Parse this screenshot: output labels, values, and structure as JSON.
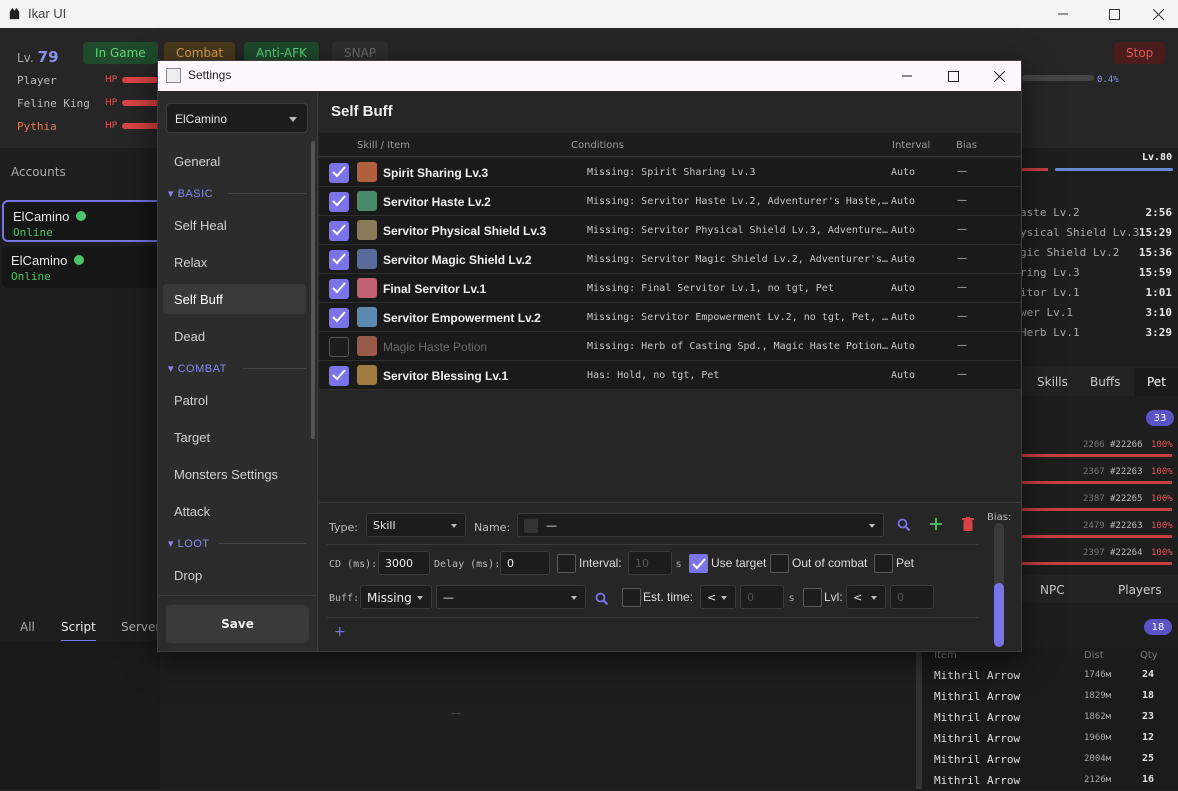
{
  "app": {
    "title": "Ikar UI",
    "level_label": "Lv.",
    "level": "79",
    "status_pills": [
      "In Game",
      "Combat",
      "Anti-AFK",
      "SNAP"
    ],
    "stop_label": "Stop",
    "party": [
      {
        "name": "Player",
        "hp": "HP"
      },
      {
        "name": "Feline King",
        "hp": "HP"
      },
      {
        "name": "Pythia",
        "hp": "HP"
      }
    ],
    "xp_percent": "0.4%",
    "accounts_header": "Accounts",
    "accounts": [
      {
        "name": "ElCamino",
        "status": "Online"
      },
      {
        "name": "ElCamino",
        "status": "Online"
      }
    ],
    "bottom_tabs": [
      "All",
      "Script",
      "Server"
    ],
    "right": {
      "pet_level": "Lv.80",
      "buffs": [
        {
          "name": "aste Lv.2",
          "time": "2:56"
        },
        {
          "name": "ysical Shield Lv.3",
          "time": "15:29"
        },
        {
          "name": "gic Shield Lv.2",
          "time": "15:36"
        },
        {
          "name": "ring Lv.3",
          "time": "15:59"
        },
        {
          "name": "itor Lv.1",
          "time": "1:01"
        },
        {
          "name": "wer Lv.1",
          "time": "3:10"
        },
        {
          "name": "Herb Lv.1",
          "time": "3:29"
        }
      ],
      "tabs": [
        "Skills",
        "Buffs",
        "Pet"
      ],
      "targets_count": "33",
      "targets": [
        {
          "dist": "2266",
          "id": "#22266",
          "pct": "100%"
        },
        {
          "dist": "2367",
          "id": "#22263",
          "pct": "100%"
        },
        {
          "dist": "2387",
          "id": "#22265",
          "pct": "100%"
        },
        {
          "dist": "2479",
          "id": "#22263",
          "pct": "100%"
        },
        {
          "dist": "2397",
          "id": "#22264",
          "pct": "100%"
        }
      ],
      "tabs2": [
        "NPC",
        "Players"
      ],
      "items_count": "18",
      "items_headers": [
        "Item",
        "Dist",
        "Qty"
      ],
      "items": [
        {
          "name": "Mithril Arrow",
          "dist": "1746м",
          "qty": "24"
        },
        {
          "name": "Mithril Arrow",
          "dist": "1829м",
          "qty": "18"
        },
        {
          "name": "Mithril Arrow",
          "dist": "1862м",
          "qty": "23"
        },
        {
          "name": "Mithril Arrow",
          "dist": "1960м",
          "qty": "12"
        },
        {
          "name": "Mithril Arrow",
          "dist": "2004м",
          "qty": "25"
        },
        {
          "name": "Mithril Arrow",
          "dist": "2126м",
          "qty": "16"
        }
      ]
    },
    "center_dash": "—"
  },
  "dialog": {
    "title": "Settings",
    "account": "ElCamino",
    "nav": {
      "general": "General",
      "basic": "BASIC",
      "self_heal": "Self Heal",
      "relax": "Relax",
      "self_buff": "Self Buff",
      "dead": "Dead",
      "combat": "COMBAT",
      "patrol": "Patrol",
      "target": "Target",
      "monsters_settings": "Monsters Settings",
      "attack": "Attack",
      "loot": "LOOT",
      "drop": "Drop"
    },
    "save": "Save",
    "page_title": "Self Buff",
    "columns": {
      "skill": "Skill / Item",
      "conditions": "Conditions",
      "interval": "Interval",
      "bias": "Bias"
    },
    "rows": [
      {
        "checked": true,
        "name": "Spirit Sharing Lv.3",
        "cond": "Missing: Spirit Sharing Lv.3",
        "interval": "Auto",
        "bias": "—",
        "icon": "#b0603a"
      },
      {
        "checked": true,
        "name": "Servitor Haste Lv.2",
        "cond": "Missing: Servitor Haste Lv.2, Adventurer's Haste, Pet",
        "interval": "Auto",
        "bias": "—",
        "icon": "#4a8a6a"
      },
      {
        "checked": true,
        "name": "Servitor Physical Shield Lv.3",
        "cond": "Missing: Servitor Physical Shield Lv.3, Adventurer's Shield, Pet",
        "interval": "Auto",
        "bias": "—",
        "icon": "#8a7a5a"
      },
      {
        "checked": true,
        "name": "Servitor Magic Shield Lv.2",
        "cond": "Missing: Servitor Magic Shield Lv.2, Adventurer's Magic Barrier, Pet",
        "interval": "Auto",
        "bias": "—",
        "icon": "#5a6a9a"
      },
      {
        "checked": true,
        "name": "Final Servitor Lv.1",
        "cond": "Missing: Final Servitor Lv.1, no tgt, Pet",
        "interval": "Auto",
        "bias": "—",
        "icon": "#c06070"
      },
      {
        "checked": true,
        "name": "Servitor Empowerment Lv.2",
        "cond": "Missing: Servitor Empowerment Lv.2, no tgt, Pet, Hold",
        "interval": "Auto",
        "bias": "—",
        "icon": "#5a8ab0"
      },
      {
        "checked": false,
        "name": "Magic Haste Potion",
        "cond": "Missing: Herb of Casting Spd., Magic Haste Potion, Pet",
        "interval": "Auto",
        "bias": "—",
        "icon": "#9a5a4a"
      },
      {
        "checked": true,
        "name": "Servitor Blessing Lv.1",
        "cond": "Has: Hold, no tgt, Pet",
        "interval": "Auto",
        "bias": "—",
        "icon": "#a07a40"
      }
    ],
    "editor": {
      "type_label": "Type:",
      "type_value": "Skill",
      "name_label": "Name:",
      "name_value": "—",
      "bias_label": "Bias:",
      "cd_label": "CD (ms):",
      "cd_value": "3000",
      "delay_label": "Delay (ms):",
      "delay_value": "0",
      "interval_label": "Interval:",
      "interval_value": "10",
      "s": "s",
      "use_target": "Use target",
      "out_of_combat": "Out of combat",
      "pet": "Pet",
      "buff_label": "Buff:",
      "buff_mode": "Missing",
      "buff_value": "—",
      "est_label": "Est. time:",
      "est_op": "<",
      "est_value": "0",
      "lvl_label": "Lvl:",
      "lvl_op": "<",
      "lvl_value": "0",
      "add": "+"
    }
  }
}
